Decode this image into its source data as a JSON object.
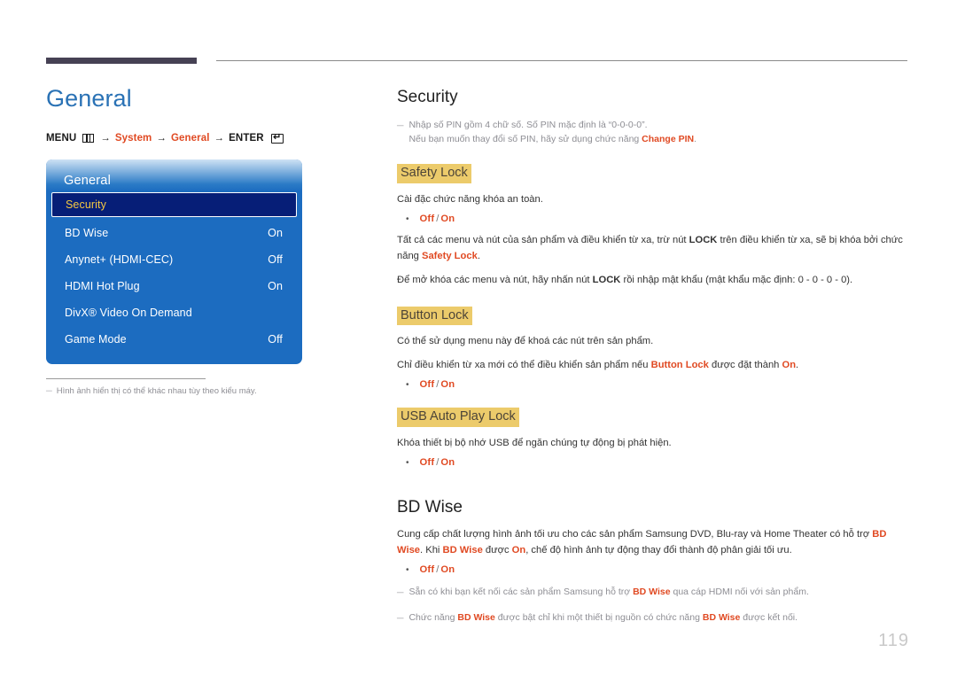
{
  "page": {
    "number": "119"
  },
  "left": {
    "title": "General",
    "breadcrumb": {
      "menu_label": "MENU",
      "menu_icon": "menu-grid-icon",
      "arrow": "→",
      "system_label": "System",
      "general_label": "General",
      "enter_label": "ENTER",
      "enter_icon": "enter-return-icon"
    },
    "osd": {
      "header": "General",
      "rows": [
        {
          "label": "Security",
          "value": "",
          "selected": true
        },
        {
          "label": "BD Wise",
          "value": "On",
          "selected": false
        },
        {
          "label": "Anynet+ (HDMI-CEC)",
          "value": "Off",
          "selected": false
        },
        {
          "label": "HDMI Hot Plug",
          "value": "On",
          "selected": false
        },
        {
          "label": "DivX® Video On Demand",
          "value": "",
          "selected": false
        },
        {
          "label": "Game Mode",
          "value": "Off",
          "selected": false
        }
      ]
    },
    "note": {
      "dash": "─",
      "text": "Hình ảnh hiển thị có thể khác nhau tùy theo kiểu máy."
    }
  },
  "right": {
    "security": {
      "title": "Security",
      "note_dash": "─",
      "note_line1": "Nhập số PIN gồm 4 chữ số. Số PIN mặc định là “0-0-0-0”.",
      "note_line2_pre": "Nếu bạn muốn thay đổi số PIN, hãy sử dụng chức năng ",
      "note_line2_accent": "Change PIN",
      "note_line2_post": "."
    },
    "safety_lock": {
      "heading": "Safety Lock",
      "intro": "Cài đặc chức năng khóa an toàn.",
      "option_off": "Off",
      "option_sep": "/",
      "option_on": "On",
      "para1_a": "Tất cả các menu và nút của sản phẩm và điều khiển từ xa, trừ nút ",
      "para1_bold": "LOCK",
      "para1_b": " trên điều khiển từ xa, sẽ bị khóa bởi chức năng ",
      "para1_accent": "Safety Lock",
      "para1_c": ".",
      "para2_a": "Để mở khóa các menu và nút, hãy nhấn nút ",
      "para2_bold": "LOCK",
      "para2_b": " rồi nhập mật khẩu (mật khẩu mặc định: 0 - 0 - 0 - 0)."
    },
    "button_lock": {
      "heading": "Button Lock",
      "para1": "Có thể sử dụng menu này để khoá các nút trên sản phẩm.",
      "para2_a": "Chỉ điều khiển từ xa mới có thể điều khiển sản phẩm nếu ",
      "para2_accent1": "Button Lock",
      "para2_b": " được đặt thành ",
      "para2_accent2": "On",
      "para2_c": ".",
      "option_off": "Off",
      "option_sep": "/",
      "option_on": "On"
    },
    "usb_auto_play_lock": {
      "heading": "USB Auto Play Lock",
      "para1": "Khóa thiết bị bộ nhớ USB để ngăn chúng tự động bị phát hiện.",
      "option_off": "Off",
      "option_sep": "/",
      "option_on": "On"
    },
    "bd_wise": {
      "title": "BD Wise",
      "para1_a": "Cung cấp chất lượng hình ảnh tối ưu cho các sản phẩm Samsung DVD, Blu-ray và Home Theater có hỗ trợ ",
      "para1_accent1": "BD Wise",
      "para1_b": ". Khi ",
      "para1_accent2": "BD Wise",
      "para1_c": " được ",
      "para1_accent3": "On",
      "para1_d": ", chế độ hình ảnh tự động thay đổi thành độ phân giải tối ưu.",
      "option_off": "Off",
      "option_sep": "/",
      "option_on": "On",
      "note_dash": "─",
      "note1_a": "Sẵn có khi bạn kết nối các sản phẩm Samsung hỗ trợ ",
      "note1_accent": "BD Wise",
      "note1_b": " qua cáp HDMI nối với sản phẩm.",
      "note2_a": "Chức năng ",
      "note2_accent1": "BD Wise",
      "note2_b": " được bật chỉ khi một thiết bị nguồn có chức năng ",
      "note2_accent2": "BD Wise",
      "note2_c": " được kết nối."
    }
  }
}
